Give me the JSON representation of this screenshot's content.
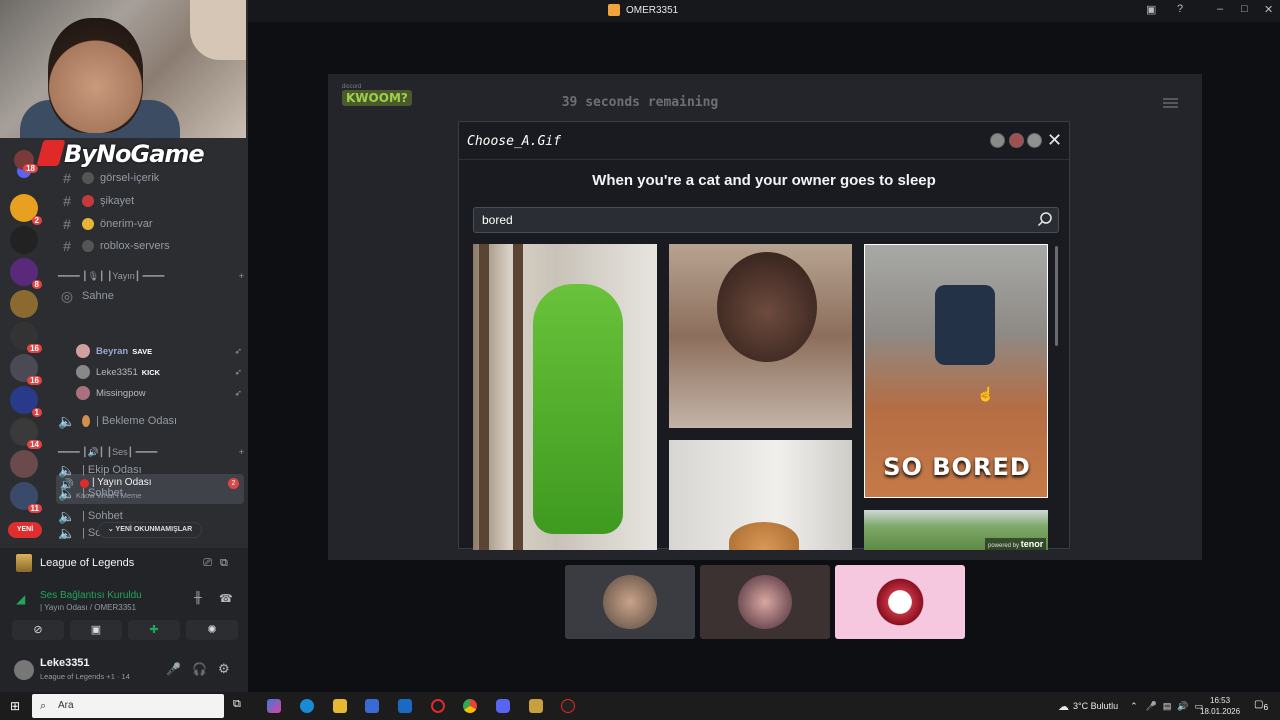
{
  "window": {
    "title": "OMER3351"
  },
  "brand": "ByNoGame",
  "sidebar": {
    "channels": [
      {
        "name": "görsel-içerik"
      },
      {
        "name": "şikayet"
      },
      {
        "name": "önerim-var"
      },
      {
        "name": "roblox-servers"
      }
    ],
    "category_yayin": "━━━━ ┃🎙┃ ┃Yayın┃ ━━━━",
    "stage": "Sahne",
    "voice_room": {
      "name": "| Yayın Odası",
      "status": "Know What I Meme",
      "badge": "2"
    },
    "voice_users": [
      {
        "name": "Beyran",
        "tag": "SAVE"
      },
      {
        "name": "Leke3351",
        "tag": "KICK"
      },
      {
        "name": "Missingpow",
        "tag": ""
      }
    ],
    "waiting_room": "| Bekleme Odası",
    "category_ses": "━━━━ ┃🔊┃ ┃Ses┃ ━━━━",
    "ekip": "| Ekip Odası",
    "sohbet1": "| Sohbet",
    "sohbet2": "| Sohbet",
    "sohbet3": "| Sohbet",
    "server_badges": [
      "18",
      "2",
      "8",
      "16",
      "16",
      "1",
      "14",
      "11"
    ],
    "new_pill": "YENİ OKUNMAMIŞLAR",
    "new_red": "YENİ"
  },
  "panel": {
    "game": "League of Legends",
    "voice_status": "Ses Bağlantısı Kuruldu",
    "voice_sub": "| Yayın Odası / OMER3351",
    "username": "Leke3351",
    "user_status": "League of Legends +1 · 14"
  },
  "game": {
    "discord_label": "discord",
    "logo": "KWOOM?",
    "timer_num": "39",
    "timer_text": "seconds remaining",
    "dialog_title": "Choose_A.Gif",
    "prompt": "When you're a cat and your owner goes to sleep",
    "search_value": "bored",
    "gif_caption": "SO BORED",
    "powered_by": "powered by",
    "tenor": "tenor"
  },
  "taskbar": {
    "search_placeholder": "Ara",
    "weather": "3°C  Bulutlu",
    "time": "16:53",
    "date": "18.01.2026",
    "notif_count": "6"
  }
}
